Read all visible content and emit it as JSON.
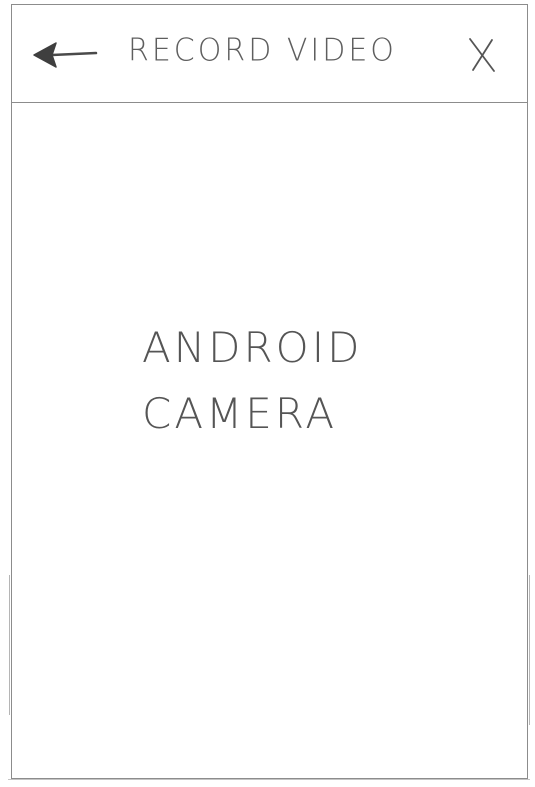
{
  "header": {
    "title": "RECORD VIDEO",
    "back_icon": "back-arrow-icon",
    "close_label": "X"
  },
  "content": {
    "line1": "ANDROID",
    "line2": "CAMERA"
  },
  "colors": {
    "pencil": "#5a5a5a",
    "frame": "#8c8c8c",
    "paper": "#ffffff"
  }
}
